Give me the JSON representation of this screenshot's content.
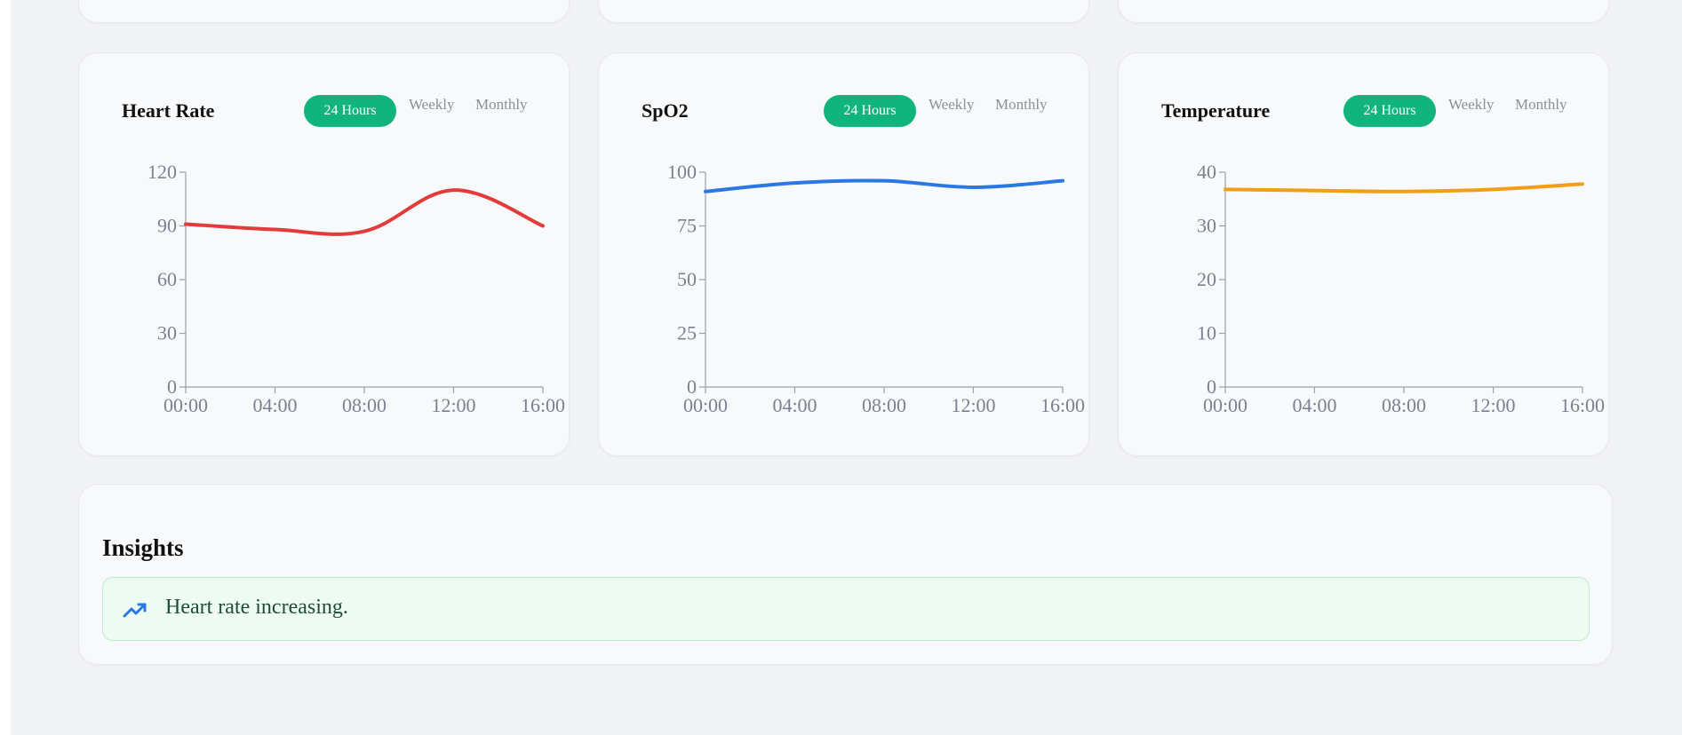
{
  "cards": [
    {
      "title": "Heart Rate",
      "tabs": {
        "active": "24 Hours",
        "weekly": "Weekly",
        "monthly": "Monthly"
      },
      "color": "#e23b3b",
      "chart_data": {
        "type": "line",
        "x": [
          "00:00",
          "04:00",
          "08:00",
          "12:00",
          "16:00"
        ],
        "yticks": [
          "0",
          "30",
          "60",
          "90",
          "120"
        ],
        "ylim": [
          0,
          120
        ],
        "series": [
          {
            "values": [
              91,
              88,
              87,
              110,
              90
            ]
          }
        ]
      }
    },
    {
      "title": "SpO2",
      "tabs": {
        "active": "24 Hours",
        "weekly": "Weekly",
        "monthly": "Monthly"
      },
      "color": "#2a78e4",
      "chart_data": {
        "type": "line",
        "x": [
          "00:00",
          "04:00",
          "08:00",
          "12:00",
          "16:00"
        ],
        "yticks": [
          "0",
          "25",
          "50",
          "75",
          "100"
        ],
        "ylim": [
          0,
          100
        ],
        "series": [
          {
            "values": [
              91,
              95,
              96,
              93,
              96
            ]
          }
        ]
      }
    },
    {
      "title": "Temperature",
      "tabs": {
        "active": "24 Hours",
        "weekly": "Weekly",
        "monthly": "Monthly"
      },
      "color": "#f29d16",
      "chart_data": {
        "type": "line",
        "x": [
          "00:00",
          "04:00",
          "08:00",
          "12:00",
          "16:00"
        ],
        "yticks": [
          "0",
          "10",
          "20",
          "30",
          "40"
        ],
        "ylim": [
          0,
          40
        ],
        "series": [
          {
            "values": [
              36.8,
              36.6,
              36.4,
              36.8,
              37.8
            ]
          }
        ]
      }
    }
  ],
  "insights": {
    "title": "Insights",
    "icon": "trending-up-icon",
    "icon_color": "#2a78e4",
    "items": [
      {
        "text": "Heart rate increasing."
      }
    ]
  }
}
